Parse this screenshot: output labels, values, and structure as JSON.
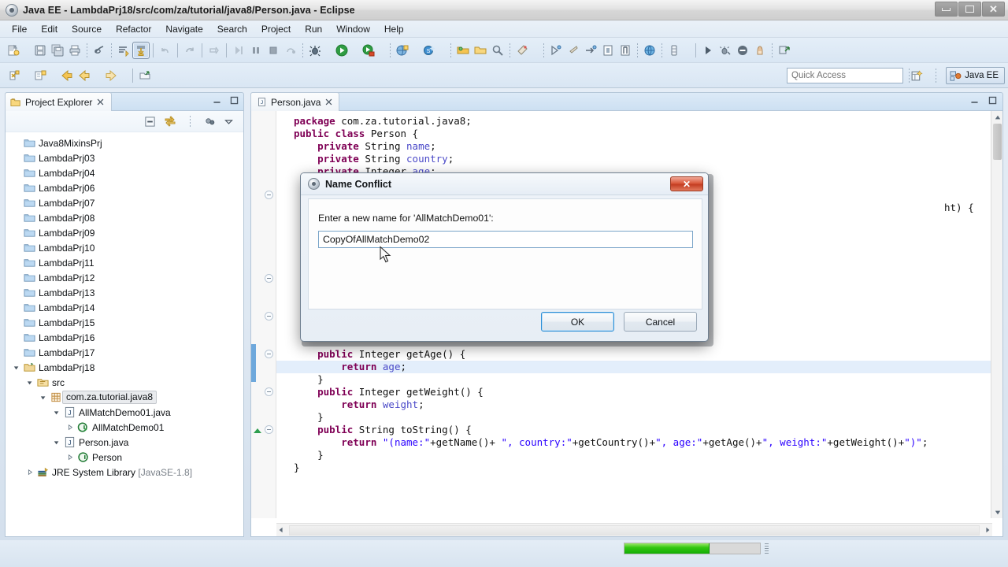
{
  "window": {
    "title": "Java EE - LambdaPrj18/src/com/za/tutorial/java8/Person.java - Eclipse",
    "app_icon": "eclipse-icon",
    "minimize_label": "Minimize",
    "maximize_label": "Maximize",
    "close_label": "Close"
  },
  "menubar": {
    "items": [
      {
        "label": "File"
      },
      {
        "label": "Edit"
      },
      {
        "label": "Source"
      },
      {
        "label": "Refactor"
      },
      {
        "label": "Navigate"
      },
      {
        "label": "Search"
      },
      {
        "label": "Project"
      },
      {
        "label": "Run"
      },
      {
        "label": "Window"
      },
      {
        "label": "Help"
      }
    ]
  },
  "toolbar": {
    "row1": [
      "new-wizard-icon",
      "new-wizard-dropdown",
      "save-icon",
      "save-all-icon",
      "print-icon",
      "toggle-mark-occurrences-icon",
      "open-task-icon",
      "skip-breakpoints-icon",
      "build-icon",
      "undo-icon",
      "redo-icon",
      "next-annotation-icon",
      "pause-icon",
      "terminate-icon",
      "step-icon",
      "debug-icon",
      "debug-dropdown",
      "run-icon",
      "run-dropdown",
      "coverage-icon",
      "coverage-dropdown",
      "new-java-project-icon",
      "new-java-project-dropdown",
      "new-class-icon",
      "new-class-dropdown",
      "open-type-icon",
      "open-folder-icon",
      "search-icon",
      "external-tools-icon",
      "external-tools-dropdown",
      "next-edit-icon",
      "previous-edit-icon",
      "last-edit-icon",
      "toggle-block-selection-icon",
      "show-whitespace-icon",
      "open-web-browser-icon",
      "open-perspective-icon",
      "perspective-dropdown",
      "forward-icon",
      "debug-config-icon",
      "remove-icon",
      "pin-icon",
      "link-icon"
    ],
    "row2": [
      "new-annotation-icon",
      "new-annotation-dropdown",
      "new-package-icon",
      "new-package-dropdown",
      "back-history-icon",
      "back-icon",
      "back-dropdown",
      "forward-nav-icon",
      "forward-dropdown",
      "open-declaration-icon"
    ]
  },
  "quick_access": {
    "placeholder": "Quick Access",
    "value": ""
  },
  "perspective": {
    "open_perspective_label": "Open Perspective",
    "current_label": "Java EE",
    "current_icon": "java-ee-perspective-icon"
  },
  "project_explorer": {
    "tab_label": "Project Explorer",
    "tab_icon": "project-explorer-icon",
    "close_icon": "close-icon",
    "minimize_icon": "minimize-view-icon",
    "maximize_icon": "maximize-view-icon",
    "toolbar": [
      "collapse-all-icon",
      "link-with-editor-icon",
      "focus-on-active-task-icon",
      "view-menu-icon"
    ],
    "tree": [
      {
        "label": "Java8MixinsPrj",
        "indent": 0,
        "icon": "folder-icon",
        "twisty": "",
        "selected": false
      },
      {
        "label": "LambdaPrj03",
        "indent": 0,
        "icon": "folder-icon",
        "twisty": "",
        "selected": false
      },
      {
        "label": "LambdaPrj04",
        "indent": 0,
        "icon": "folder-icon",
        "twisty": "",
        "selected": false
      },
      {
        "label": "LambdaPrj06",
        "indent": 0,
        "icon": "folder-icon",
        "twisty": "",
        "selected": false
      },
      {
        "label": "LambdaPrj07",
        "indent": 0,
        "icon": "folder-icon",
        "twisty": "",
        "selected": false
      },
      {
        "label": "LambdaPrj08",
        "indent": 0,
        "icon": "folder-icon",
        "twisty": "",
        "selected": false
      },
      {
        "label": "LambdaPrj09",
        "indent": 0,
        "icon": "folder-icon",
        "twisty": "",
        "selected": false
      },
      {
        "label": "LambdaPrj10",
        "indent": 0,
        "icon": "folder-icon",
        "twisty": "",
        "selected": false
      },
      {
        "label": "LambdaPrj11",
        "indent": 0,
        "icon": "folder-icon",
        "twisty": "",
        "selected": false
      },
      {
        "label": "LambdaPrj12",
        "indent": 0,
        "icon": "folder-icon",
        "twisty": "",
        "selected": false
      },
      {
        "label": "LambdaPrj13",
        "indent": 0,
        "icon": "folder-icon",
        "twisty": "",
        "selected": false
      },
      {
        "label": "LambdaPrj14",
        "indent": 0,
        "icon": "folder-icon",
        "twisty": "",
        "selected": false
      },
      {
        "label": "LambdaPrj15",
        "indent": 0,
        "icon": "folder-icon",
        "twisty": "",
        "selected": false
      },
      {
        "label": "LambdaPrj16",
        "indent": 0,
        "icon": "folder-icon",
        "twisty": "",
        "selected": false
      },
      {
        "label": "LambdaPrj17",
        "indent": 0,
        "icon": "folder-icon",
        "twisty": "",
        "selected": false
      },
      {
        "label": "LambdaPrj18",
        "indent": 0,
        "icon": "java-project-icon",
        "twisty": "expanded",
        "selected": false
      },
      {
        "label": "src",
        "indent": 1,
        "icon": "source-folder-icon",
        "twisty": "expanded",
        "selected": false
      },
      {
        "label": "com.za.tutorial.java8",
        "indent": 2,
        "icon": "package-icon",
        "twisty": "expanded",
        "selected": true
      },
      {
        "label": "AllMatchDemo01.java",
        "indent": 3,
        "icon": "java-file-icon",
        "twisty": "expanded",
        "selected": false
      },
      {
        "label": "AllMatchDemo01",
        "indent": 4,
        "icon": "class-runnable-icon",
        "twisty": "collapsed",
        "selected": false
      },
      {
        "label": "Person.java",
        "indent": 3,
        "icon": "java-file-icon",
        "twisty": "expanded",
        "selected": false
      },
      {
        "label": "Person",
        "indent": 4,
        "icon": "class-icon",
        "twisty": "collapsed",
        "selected": false
      },
      {
        "label": "JRE System Library",
        "indent": 1,
        "icon": "library-icon",
        "twisty": "collapsed",
        "selected": false,
        "suffix": "[JavaSE-1.8]"
      }
    ]
  },
  "editor": {
    "tab_label": "Person.java",
    "tab_icon": "java-file-icon",
    "tab_close_icon": "close-icon",
    "minimize_icon": "minimize-view-icon",
    "maximize_icon": "maximize-view-icon",
    "code_lines": [
      {
        "indent": 1,
        "tokens": [
          {
            "t": "kw",
            "v": "package"
          },
          {
            "t": "p",
            "v": " com.za.tutorial.java8;"
          }
        ]
      },
      {
        "indent": 1,
        "tokens": [
          {
            "t": "kw",
            "v": "public class"
          },
          {
            "t": "p",
            "v": " Person {"
          }
        ]
      },
      {
        "indent": 2,
        "tokens": [
          {
            "t": "kw",
            "v": "private"
          },
          {
            "t": "p",
            "v": " String "
          },
          {
            "t": "fld",
            "v": "name"
          },
          {
            "t": "p",
            "v": ";"
          }
        ]
      },
      {
        "indent": 2,
        "tokens": [
          {
            "t": "kw",
            "v": "private"
          },
          {
            "t": "p",
            "v": " String "
          },
          {
            "t": "fld",
            "v": "country"
          },
          {
            "t": "p",
            "v": ";"
          }
        ]
      },
      {
        "indent": 2,
        "tokens": [
          {
            "t": "kw",
            "v": "private"
          },
          {
            "t": "p",
            "v": " Integer "
          },
          {
            "t": "fld",
            "v": "age"
          },
          {
            "t": "p",
            "v": ";"
          }
        ]
      }
    ],
    "occluded_fragment": "ht) {",
    "code_lines_bottom": [
      {
        "indent": 2,
        "hl": false,
        "tokens": [
          {
            "t": "kw",
            "v": "public"
          },
          {
            "t": "p",
            "v": " Integer getAge() {"
          }
        ]
      },
      {
        "indent": 3,
        "hl": true,
        "tokens": [
          {
            "t": "kw",
            "v": "return"
          },
          {
            "t": "p",
            "v": " "
          },
          {
            "t": "fld",
            "v": "age"
          },
          {
            "t": "p",
            "v": ";"
          }
        ]
      },
      {
        "indent": 2,
        "hl": false,
        "tokens": [
          {
            "t": "p",
            "v": "}"
          }
        ]
      },
      {
        "indent": 2,
        "hl": false,
        "tokens": [
          {
            "t": "kw",
            "v": "public"
          },
          {
            "t": "p",
            "v": " Integer getWeight() {"
          }
        ]
      },
      {
        "indent": 3,
        "hl": false,
        "tokens": [
          {
            "t": "kw",
            "v": "return"
          },
          {
            "t": "p",
            "v": " "
          },
          {
            "t": "fld",
            "v": "weight"
          },
          {
            "t": "p",
            "v": ";"
          }
        ]
      },
      {
        "indent": 2,
        "hl": false,
        "tokens": [
          {
            "t": "p",
            "v": "}"
          }
        ]
      },
      {
        "indent": 2,
        "hl": false,
        "tokens": [
          {
            "t": "kw",
            "v": "public"
          },
          {
            "t": "p",
            "v": " String toString() {"
          }
        ]
      },
      {
        "indent": 3,
        "hl": false,
        "tokens": [
          {
            "t": "kw",
            "v": "return"
          },
          {
            "t": "p",
            "v": " "
          },
          {
            "t": "str",
            "v": "\"(name:\""
          },
          {
            "t": "p",
            "v": "+getName()+ "
          },
          {
            "t": "str",
            "v": "\", country:\""
          },
          {
            "t": "p",
            "v": "+getCountry()+"
          },
          {
            "t": "str",
            "v": "\", age:\""
          },
          {
            "t": "p",
            "v": "+getAge()+"
          },
          {
            "t": "str",
            "v": "\", weight:\""
          },
          {
            "t": "p",
            "v": "+getWeight()+"
          },
          {
            "t": "str",
            "v": "\")\""
          },
          {
            "t": "p",
            "v": ";"
          }
        ]
      },
      {
        "indent": 2,
        "hl": false,
        "tokens": [
          {
            "t": "p",
            "v": "}"
          }
        ]
      },
      {
        "indent": 1,
        "hl": false,
        "tokens": [
          {
            "t": "p",
            "v": "}"
          }
        ]
      }
    ]
  },
  "dialog": {
    "title": "Name Conflict",
    "title_icon": "eclipse-icon",
    "close_label": "✕",
    "prompt": "Enter a new name for 'AllMatchDemo01':",
    "input_value": "CopyOfAllMatchDemo02",
    "input_placeholder": "",
    "ok_label": "OK",
    "cancel_label": "Cancel"
  },
  "status": {
    "progress_percent": 63
  },
  "colors": {
    "accent": "#2c8fd6",
    "progress_green": "#34c712",
    "keyword": "#7f0055",
    "string": "#2a00ff",
    "field": "#4a49c8",
    "selection": "#e3eefb",
    "close_red": "#c33d22"
  }
}
